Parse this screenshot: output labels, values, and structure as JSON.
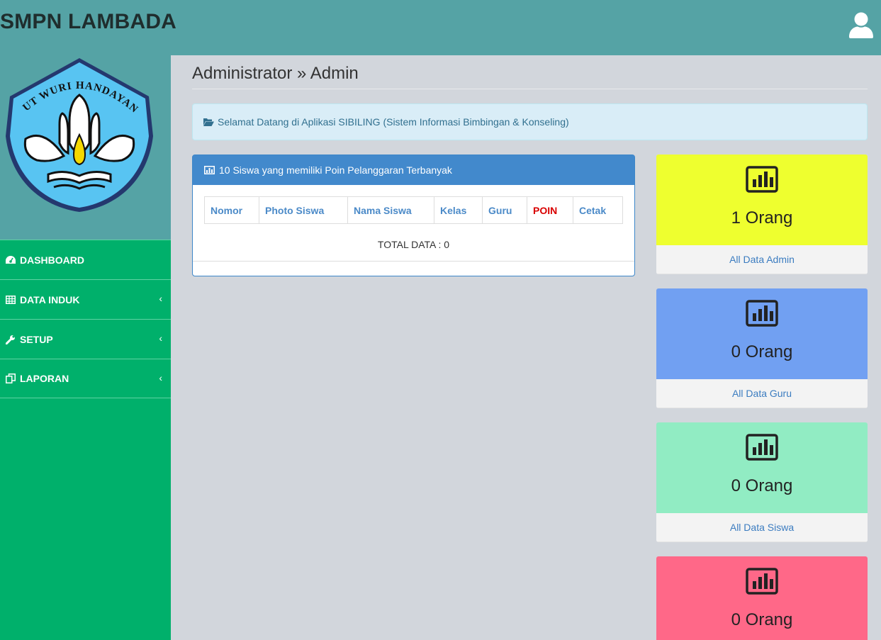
{
  "app": {
    "title": "SMPN LAMBADA"
  },
  "logo": {
    "text": "TUT WURI HANDAYANI"
  },
  "sidebar": {
    "items": [
      {
        "label": "DASHBOARD",
        "icon": "dashboard-icon",
        "has_submenu": false
      },
      {
        "label": "DATA INDUK",
        "icon": "table-icon",
        "has_submenu": true
      },
      {
        "label": "SETUP",
        "icon": "wrench-icon",
        "has_submenu": true
      },
      {
        "label": "LAPORAN",
        "icon": "copy-icon",
        "has_submenu": true
      }
    ]
  },
  "page": {
    "title": "Administrator » Admin"
  },
  "alert": {
    "text": "Selamat Datang di Aplikasi SIBILING (Sistem Informasi Bimbingan & Konseling)",
    "icon": "folder-open-icon"
  },
  "panel": {
    "title": "10 Siswa yang memiliki Poin Pelanggaran Terbanyak",
    "icon": "bar-chart-icon",
    "columns": [
      "Nomor",
      "Photo Siswa",
      "Nama Siswa",
      "Kelas",
      "Guru",
      "POIN",
      "Cetak"
    ],
    "total": "TOTAL DATA : 0"
  },
  "cards": [
    {
      "count": "1 Orang",
      "link": "All Data Admin",
      "color": "#eeff2f"
    },
    {
      "count": "0 Orang",
      "link": "All Data Guru",
      "color": "#71a0f2"
    },
    {
      "count": "0 Orang",
      "link": "All Data Siswa",
      "color": "#91ecc3"
    },
    {
      "count": "0 Orang",
      "link": "",
      "color": "#ff6888"
    }
  ],
  "colors": {
    "topbar": "#55a3a5",
    "sidebar": "#00b06b",
    "panel_head": "#4289cc",
    "poin": "#d90000"
  }
}
